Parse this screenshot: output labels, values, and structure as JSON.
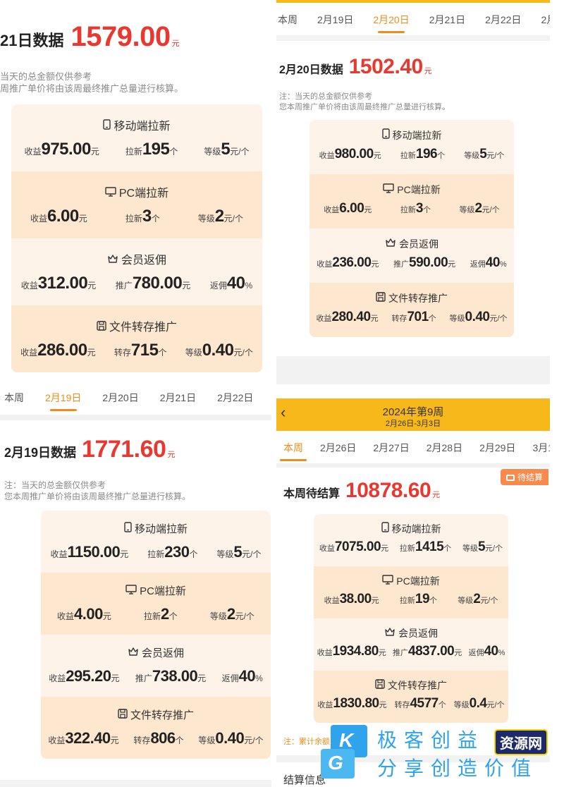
{
  "panel_a": {
    "tabs": [
      "本周",
      "2月19日",
      "2月20日",
      "2月21日",
      "2月22日"
    ],
    "heading_label": "21日数据",
    "amount": "1579.00",
    "unit": "元",
    "note_line1": "当天的总金额仅供参考",
    "note_line2": "周推广单价将由该周最终推广总量进行核算。",
    "sections": [
      {
        "title": "移动端拉新",
        "icon": "phone-icon",
        "stats": [
          [
            "收益",
            "975.00",
            "元"
          ],
          [
            "拉新",
            "195",
            "个"
          ],
          [
            "等级",
            "5",
            "元/个"
          ]
        ]
      },
      {
        "title": "PC端拉新",
        "icon": "monitor-icon",
        "stats": [
          [
            "收益",
            "6.00",
            "元"
          ],
          [
            "拉新",
            "3",
            "个"
          ],
          [
            "等级",
            "2",
            "元/个"
          ]
        ]
      },
      {
        "title": "会员返佣",
        "icon": "crown-icon",
        "stats": [
          [
            "收益",
            "312.00",
            "元"
          ],
          [
            "推广",
            "780.00",
            "元"
          ],
          [
            "返佣",
            "40",
            "%"
          ]
        ]
      },
      {
        "title": "文件转存推广",
        "icon": "save-icon",
        "stats": [
          [
            "收益",
            "286.00",
            "元"
          ],
          [
            "转存",
            "715",
            "个"
          ],
          [
            "等级",
            "0.40",
            "元/个"
          ]
        ]
      }
    ]
  },
  "panel_b": {
    "tabs": [
      "本周",
      "2月19日",
      "2月20日",
      "2月21日",
      "2月22日",
      "2月"
    ],
    "active_tab": 2,
    "heading_label": "2月20日数据",
    "amount": "1502.40",
    "unit": "元",
    "note_line1": "注：当天的总金额仅供参考",
    "note_line2": "您本周推广单价将由该周最终推广总量进行核算。",
    "sections": [
      {
        "title": "移动端拉新",
        "icon": "phone-icon",
        "stats": [
          [
            "收益",
            "980.00",
            "元"
          ],
          [
            "拉新",
            "196",
            "个"
          ],
          [
            "等级",
            "5",
            "元/个"
          ]
        ]
      },
      {
        "title": "PC端拉新",
        "icon": "monitor-icon",
        "stats": [
          [
            "收益",
            "6.00",
            "元"
          ],
          [
            "拉新",
            "3",
            "个"
          ],
          [
            "等级",
            "2",
            "元/个"
          ]
        ]
      },
      {
        "title": "会员返佣",
        "icon": "crown-icon",
        "stats": [
          [
            "收益",
            "236.00",
            "元"
          ],
          [
            "推广",
            "590.00",
            "元"
          ],
          [
            "返佣",
            "40",
            "%"
          ]
        ]
      },
      {
        "title": "文件转存推广",
        "icon": "save-icon",
        "stats": [
          [
            "收益",
            "280.40",
            "元"
          ],
          [
            "转存",
            "701",
            "个"
          ],
          [
            "等级",
            "0.40",
            "元/个"
          ]
        ]
      }
    ]
  },
  "panel_c": {
    "tabs": [
      "本周",
      "2月19日",
      "2月20日",
      "2月21日",
      "2月22日"
    ],
    "active_tab": 1,
    "heading_label": "2月19日数据",
    "amount": "1771.60",
    "unit": "元",
    "note_line1": "注：当天的总金额仅供参考",
    "note_line2": "您本周推广单价将由该周最终推广总量进行核算。",
    "sections": [
      {
        "title": "移动端拉新",
        "icon": "phone-icon",
        "stats": [
          [
            "收益",
            "1150.00",
            "元"
          ],
          [
            "拉新",
            "230",
            "个"
          ],
          [
            "等级",
            "5",
            "元/个"
          ]
        ]
      },
      {
        "title": "PC端拉新",
        "icon": "monitor-icon",
        "stats": [
          [
            "收益",
            "4.00",
            "元"
          ],
          [
            "拉新",
            "2",
            "个"
          ],
          [
            "等级",
            "2",
            "元/个"
          ]
        ]
      },
      {
        "title": "会员返佣",
        "icon": "crown-icon",
        "stats": [
          [
            "收益",
            "295.20",
            "元"
          ],
          [
            "推广",
            "738.00",
            "元"
          ],
          [
            "返佣",
            "40",
            "%"
          ]
        ]
      },
      {
        "title": "文件转存推广",
        "icon": "save-icon",
        "stats": [
          [
            "收益",
            "322.40",
            "元"
          ],
          [
            "转存",
            "806",
            "个"
          ],
          [
            "等级",
            "0.40",
            "元/个"
          ]
        ]
      }
    ]
  },
  "panel_d": {
    "week_title": "2024年第9周",
    "week_range": "2月26日-3月3日",
    "back_glyph": "‹",
    "tabs": [
      "本周",
      "2月26日",
      "2月27日",
      "2月28日",
      "2月29日",
      "3月1"
    ],
    "active_tab": 0,
    "badge_label": "待结算",
    "heading_label": "本周待结算",
    "amount": "10878.60",
    "unit": "元",
    "sections": [
      {
        "title": "移动端拉新",
        "icon": "phone-icon",
        "stats": [
          [
            "收益",
            "7075.00",
            "元"
          ],
          [
            "拉新",
            "1415",
            "个"
          ],
          [
            "等级",
            "5",
            "元/个"
          ]
        ]
      },
      {
        "title": "PC端拉新",
        "icon": "monitor-icon",
        "stats": [
          [
            "收益",
            "38.00",
            "元"
          ],
          [
            "拉新",
            "19",
            "个"
          ],
          [
            "等级",
            "2",
            "元/个"
          ]
        ]
      },
      {
        "title": "会员返佣",
        "icon": "crown-icon",
        "stats": [
          [
            "收益",
            "1934.80",
            "元"
          ],
          [
            "推广",
            "4837.00",
            "元"
          ],
          [
            "返佣",
            "40",
            "%"
          ]
        ]
      },
      {
        "title": "文件转存推广",
        "icon": "save-icon",
        "stats": [
          [
            "收益",
            "1830.80",
            "元"
          ],
          [
            "转存",
            "4577",
            "个"
          ],
          [
            "等级",
            "0.4",
            "元/个"
          ]
        ]
      }
    ],
    "foot_note": "注：累计余额",
    "foot_label": "结算信息"
  },
  "watermark": {
    "logo_top": "K",
    "logo_bottom": "G",
    "line1": "极客创益",
    "line2": "分享创造价值",
    "badge": "资源网"
  },
  "colors": {
    "accent_red": "#e8382f",
    "accent_orange": "#f08c1c",
    "header_yellow": "#f6b81a",
    "card_bg": "#fdf3e8",
    "card_alt_bg": "#fde7cf"
  }
}
